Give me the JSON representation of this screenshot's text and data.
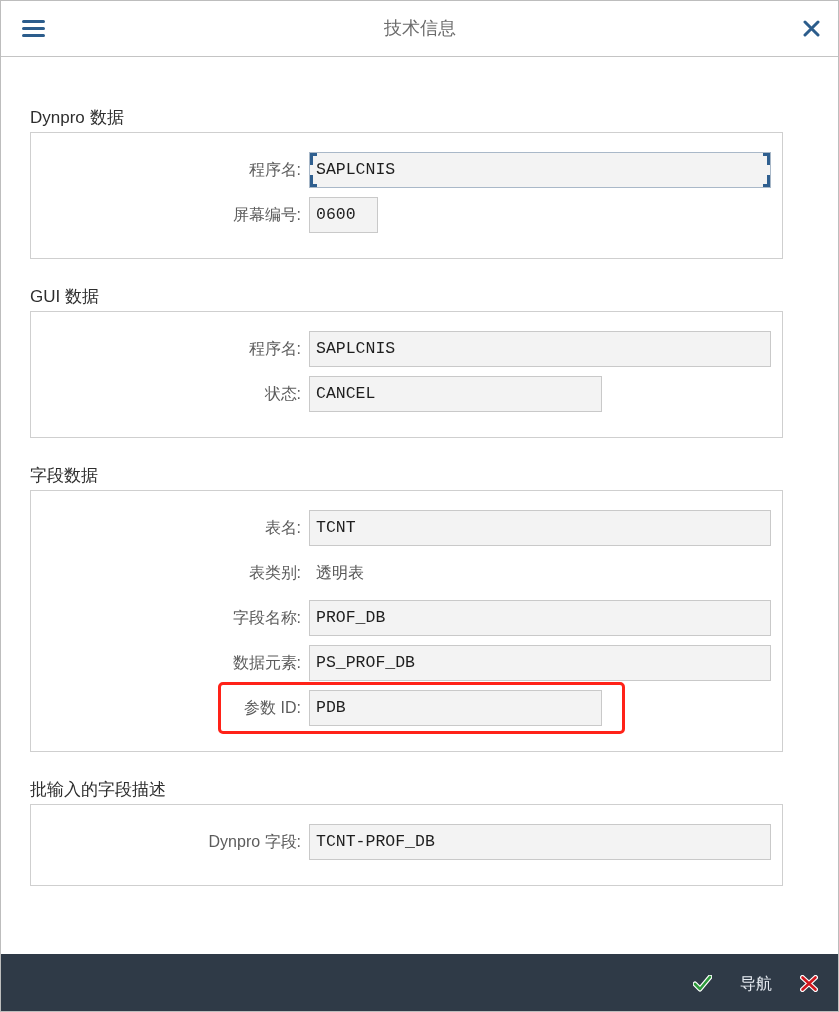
{
  "window": {
    "title": "技术信息"
  },
  "sections": [
    {
      "title": "Dynpro 数据",
      "rows": [
        {
          "label": "程序名:",
          "kind": "input",
          "value": "SAPLCNIS",
          "focused": true,
          "highlighted": false
        },
        {
          "label": "屏幕编号:",
          "kind": "input",
          "value": "0600",
          "focused": false,
          "highlighted": false
        }
      ]
    },
    {
      "title": "GUI 数据",
      "rows": [
        {
          "label": "程序名:",
          "kind": "input",
          "value": "SAPLCNIS",
          "focused": false,
          "highlighted": false
        },
        {
          "label": "状态:",
          "kind": "input",
          "value": "CANCEL",
          "focused": false,
          "highlighted": false
        }
      ]
    },
    {
      "title": "字段数据",
      "rows": [
        {
          "label": "表名:",
          "kind": "input",
          "value": "TCNT",
          "focused": false,
          "highlighted": false
        },
        {
          "label": "表类别:",
          "kind": "text",
          "value": "透明表",
          "highlighted": false
        },
        {
          "label": "字段名称:",
          "kind": "input",
          "value": "PROF_DB",
          "focused": false,
          "highlighted": false
        },
        {
          "label": "数据元素:",
          "kind": "input",
          "value": "PS_PROF_DB",
          "focused": false,
          "highlighted": false
        },
        {
          "label": "参数 ID:",
          "kind": "input",
          "value": "PDB",
          "focused": false,
          "highlighted": true
        }
      ]
    },
    {
      "title": "批输入的字段描述",
      "rows": [
        {
          "label": "Dynpro 字段:",
          "kind": "input",
          "value": "TCNT-PROF_DB",
          "focused": false,
          "highlighted": false
        }
      ]
    }
  ],
  "footer": {
    "buttons": [
      {
        "kind": "confirm"
      },
      {
        "kind": "text",
        "label": "导航"
      },
      {
        "kind": "cancel"
      }
    ]
  }
}
